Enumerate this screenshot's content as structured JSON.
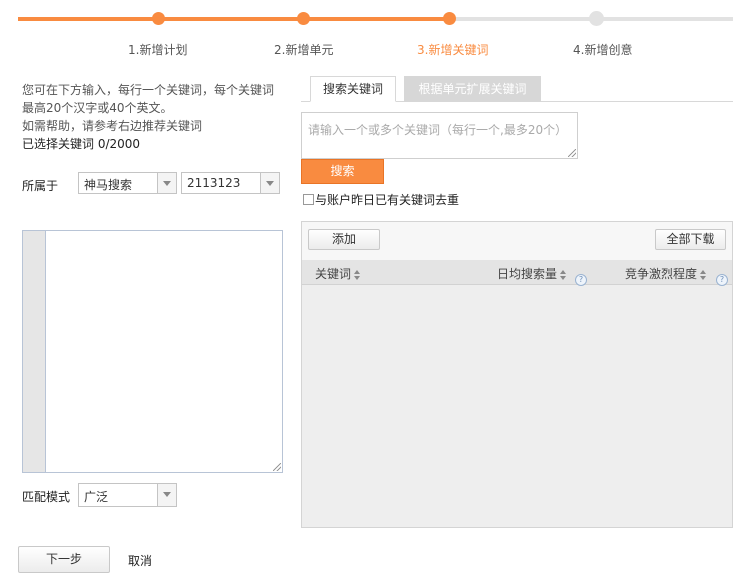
{
  "progress": {
    "steps": [
      {
        "label": "1.新增计划",
        "state": "done"
      },
      {
        "label": "2.新增单元",
        "state": "done"
      },
      {
        "label": "3.新增关键词",
        "state": "current"
      },
      {
        "label": "4.新增创意",
        "state": "todo"
      }
    ],
    "active_color": "#f98b40",
    "inactive_color": "#e2e2e2",
    "current_label_color": "#f98b40"
  },
  "left": {
    "instructions": [
      "您可在下方输入，每行一个关键词，每个关键词",
      "最高20个汉字或40个英文。",
      "如需帮助，请参考右边推荐关键词"
    ],
    "selected_count": "已选择关键词 0/2000",
    "belongs_label": "所属于",
    "engine_select": "神马搜索",
    "unit_select": "2113123",
    "keywords_textarea": "",
    "match_mode_label": "匹配模式",
    "match_mode_select": "广泛"
  },
  "right": {
    "tabs": [
      {
        "label": "搜索关键词",
        "active": true
      },
      {
        "label": "根据单元扩展关键词",
        "active": false
      }
    ],
    "search_placeholder": "请输入一个或多个关键词（每行一个,最多20个）",
    "search_button": "搜索",
    "dedupe_label": "与账户昨日已有关键词去重",
    "dedupe_checked": false,
    "add_button": "添加",
    "download_button": "全部下载",
    "columns": [
      "关键词",
      "日均搜索量",
      "竞争激烈程度"
    ],
    "help_glyph": "?"
  },
  "footer": {
    "next_button": "下一步",
    "cancel_link": "取消"
  }
}
